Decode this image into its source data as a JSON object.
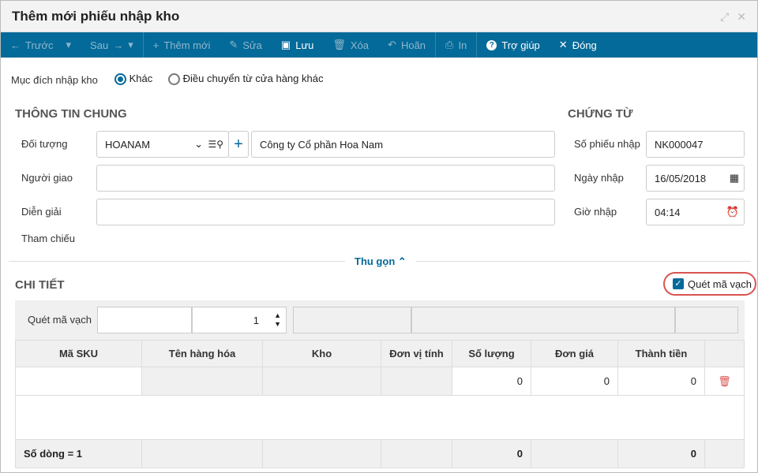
{
  "title": "Thêm mới phiếu nhập kho",
  "toolbar": {
    "prev": "Trước",
    "next": "Sau",
    "add": "Thêm mới",
    "edit": "Sửa",
    "save": "Lưu",
    "delete": "Xóa",
    "undo": "Hoãn",
    "print": "In",
    "help": "Trợ giúp",
    "close": "Đóng"
  },
  "purpose": {
    "label": "Mục đích nhập kho",
    "opt1": "Khác",
    "opt2": "Điều chuyển từ cửa hàng khác",
    "selected": "Khác"
  },
  "general": {
    "heading": "THÔNG TIN CHUNG",
    "object_label": "Đối tượng",
    "object_code": "HOANAM",
    "object_name": "Công ty Cổ phần Hoa Nam",
    "deliverer_label": "Người giao",
    "deliverer": "",
    "desc_label": "Diễn giải",
    "desc": "",
    "ref_label": "Tham chiếu"
  },
  "voucher": {
    "heading": "CHỨNG TỪ",
    "no_label": "Số phiếu nhập",
    "no": "NK000047",
    "date_label": "Ngày nhập",
    "date": "16/05/2018",
    "time_label": "Giờ nhập",
    "time": "04:14"
  },
  "collapse": "Thu gọn",
  "detail": {
    "heading": "CHI TIẾT",
    "scan_checkbox": "Quét mã vạch",
    "scan_checked": true,
    "scan_label": "Quét mã vạch",
    "scan_value": "",
    "qty": "1"
  },
  "table": {
    "headers": [
      "Mã SKU",
      "Tên hàng hóa",
      "Kho",
      "Đơn vị tính",
      "Số lượng",
      "Đơn giá",
      "Thành tiền"
    ],
    "row": [
      "",
      "",
      "",
      "",
      "0",
      "0",
      "0"
    ],
    "footer": {
      "label": "Số dòng = 1",
      "qty": "0",
      "total": "0"
    }
  }
}
